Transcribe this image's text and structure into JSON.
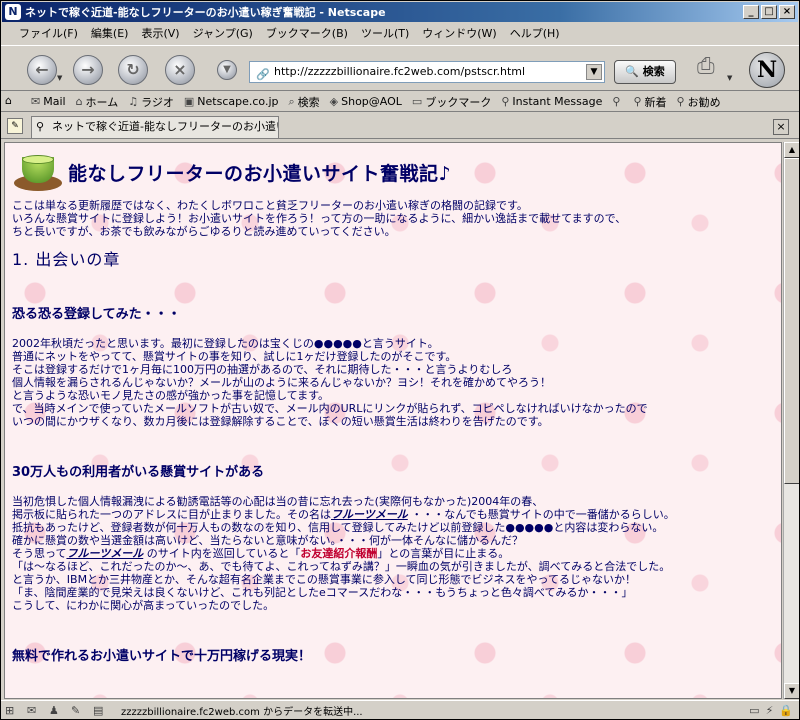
{
  "window": {
    "title": "ネットで稼ぐ近道-能なしフリーターのお小遣い稼ぎ奮戦記 - Netscape"
  },
  "menu": [
    "ファイル(F)",
    "編集(E)",
    "表示(V)",
    "ジャンプ(G)",
    "ブックマーク(B)",
    "ツール(T)",
    "ウィンドウ(W)",
    "ヘルプ(H)"
  ],
  "nav": {
    "url": "http://zzzzzbillionaire.fc2web.com/pstscr.html",
    "search_label": "検索"
  },
  "bookmarks": [
    "Mail",
    "ホーム",
    "ラジオ",
    "Netscape.co.jp",
    "検索",
    "Shop@AOL",
    "ブックマーク",
    "Instant Message",
    "",
    "新着",
    "お勧め"
  ],
  "tab": {
    "title": "ネットで稼ぐ近道-能なしフリーターのお小遣い..."
  },
  "page": {
    "title": "能なしフリーターのお小遣いサイト奮戦記♪",
    "intro": [
      "ここは単なる更新履歴ではなく、わたくしボワロこと貧乏フリーターのお小遣い稼ぎの格闘の記録です。",
      "いろんな懸賞サイトに登録しよう！お小遣いサイトを作ろう！って方の一助になるように、細かい逸話まで載せてますので、",
      "ちと長いですが、お茶でも飲みながらごゆるりと読み進めていってください。"
    ],
    "chapter": "1. 出会いの章",
    "s1_title": "恐る恐る登録してみた・・・",
    "s1_lines": [
      "2002年秋頃だったと思います。最初に登録したのは宝くじの●●●●●と言うサイト。",
      "普通にネットをやってて、懸賞サイトの事を知り、試しに1ヶだけ登録したのがそこです。",
      "そこは登録するだけで1ヶ月毎に100万円の抽選があるので、それに期待した・・・と言うよりむしろ",
      "個人情報を漏らされるんじゃないか？メールが山のように来るんじゃないか？ヨシ！それを確かめてやろう！",
      "と言うような恐いモノ見たさの感が強かった事を記憶してます。",
      "で、当時メインで使っていたメールソフトが古い奴で、メール内のURLにリンクが貼られず、コピペしなければいけなかったので",
      "いつの間にかウザくなり、数カ月後には登録解除することで、ぼくの短い懸賞生活は終わりを告げたのです。"
    ],
    "s2_title": "30万人もの利用者がいる懸賞サイトがある",
    "s2_lines": [
      "当初危惧した個人情報漏洩による勧誘電話等の心配は当の昔に忘れ去った(実際何もなかった)2004年の春、",
      "掲示板に貼られた一つのアドレスに目が止まりました。その名は",
      "抵抗もあったけど、登録者数が何十万人もの数なのを知り、信用して登録してみたけど以前登録した●●●●●と内容は変わらない。",
      "確かに懸賞の数や当選金額は高いけど、当たらないと意味がない。・・・何が一体そんなに儲かるんだ？",
      "そう思って",
      "「は～なるほど、これだったのか～、あ、でも待てよ、これってねずみ講？」一瞬血の気が引きましたが、調べてみると合法でした。",
      "と言うか、IBMとか三井物産とか、そんな超有名企業までこの懸賞事業に参入して同じ形態でビジネスをやってるじゃないか！",
      "「ま、陰間産業的で見栄えは良くないけど、これも列記としたeコマースだわな・・・もうちょっと色々調べてみるか・・・」",
      "こうして、にわかに関心が高まっていったのでした。"
    ],
    "s2_link": "フルーツメール",
    "s2_after_link": "・・・なんでも懸賞サイトの中で一番儲かるらしい。",
    "s2_mid": " のサイト内を巡回していると「",
    "s2_red": "お友達紹介報酬",
    "s2_end": "」との言葉が目に止まる。",
    "s3_title": "無料で作れるお小遣いサイトで十万円稼げる現実！"
  },
  "status": {
    "message": "zzzzzbillionaire.fc2web.com からデータを転送中..."
  }
}
